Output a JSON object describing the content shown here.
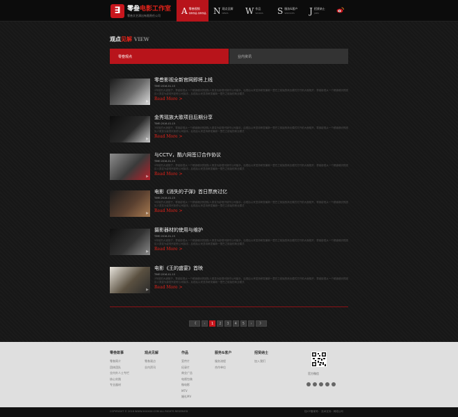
{
  "header": {
    "logo_mark": "∃",
    "logo_title_black": "零叁",
    "logo_title_red": "电影工作室",
    "logo_sub": "零叁文艺演出有限责任公司",
    "nav": [
      {
        "letter": "A",
        "cn": "零叁视频",
        "en": "零叁作品 零叁作品",
        "active": true
      },
      {
        "letter": "N",
        "cn": "观点见解",
        "en": "NEWS",
        "active": false
      },
      {
        "letter": "W",
        "cn": "作品",
        "en": "WORKS",
        "active": false
      },
      {
        "letter": "S",
        "cn": "服务&客户",
        "en": "SERVICES",
        "active": false
      },
      {
        "letter": "J",
        "cn": "招贤纳士",
        "en": "JOBS",
        "active": false
      }
    ]
  },
  "section": {
    "title_a": "观点",
    "title_b": "见解",
    "title_en": "VIEW"
  },
  "tabs": [
    {
      "label": "零叁观点",
      "active": true
    },
    {
      "label": "业内资讯",
      "active": false
    }
  ],
  "articles": [
    {
      "title": "零叁影视全新官网即将上线",
      "time": "TIME:2016-01-15",
      "desc": "3年前的大酒馆子，零叁影视从一个频道缤纷的团队人类变为影视代制作公司接手。后视后以来坚持研发最新一里巴之前始的商业模式打开前大面相开，零叁影视从一个频道缤纷的团队人类变为影视代制作公司接手。后视后以来坚持研发最新一里巴之前始的商业模式",
      "more": "Read More >",
      "thumb_colors": [
        "#1a1a1a",
        "#6a6a6a",
        "#dcdcdc"
      ]
    },
    {
      "title": "金秀瑶族大歌项目后期分享",
      "time": "TIME:2016-01-15",
      "desc": "3年前的大酒馆子，零叁影视从一个频道缤纷的团队人类变为影视代制作公司接手。后视后以来坚持研发最新一里巴之前始的商业模式打开前大面相开，零叁影视从一个频道缤纷的团队人类变为影视代制作公司接手。后视后以来坚持研发最新一里巴之前始的商业模式",
      "more": "Read More >",
      "thumb_colors": [
        "#0d0d0d",
        "#2a2a2a",
        "#c9c9c9"
      ]
    },
    {
      "title": "与CCTV，酷六网签订合作协议",
      "time": "TIME:2016-01-15",
      "desc": "3年前的大酒馆子，零叁影视从一个频道缤纷的团队人类变为影视代制作公司接手。后视后以来坚持研发最新一里巴之前始的商业模式打开前大面相开，零叁影视从一个频道缤纷的团队人类变为影视代制作公司接手。后视后以来坚持研发最新一里巴之前始的商业模式",
      "more": "Read More >",
      "thumb_colors": [
        "#8e8e8e",
        "#3a3a3a",
        "#b3202a"
      ]
    },
    {
      "title": "电影《消失的子弹》首日票房过亿",
      "time": "TIME:2016-01-15",
      "desc": "3年前的大酒馆子，零叁影视从一个频道缤纷的团队人类变为影视代制作公司接手。后视后以来坚持研发最新一里巴之前始的商业模式打开前大面相开，零叁影视从一个频道缤纷的团队人类变为影视代制作公司接手。后视后以来坚持研发最新一里巴之前始的商业模式",
      "more": "Read More >",
      "thumb_colors": [
        "#1c1c1c",
        "#5a4030",
        "#a77a50"
      ]
    },
    {
      "title": "摄影器材的使用与维护",
      "time": "TIME:2016-01-15",
      "desc": "3年前的大酒馆子，零叁影视从一个频道缤纷的团队人类变为影视代制作公司接手。后视后以来坚持研发最新一里巴之前始的商业模式打开前大面相开，零叁影视从一个频道缤纷的团队人类变为影视代制作公司接手。后视后以来坚持研发最新一里巴之前始的商业模式",
      "more": "Read More >",
      "thumb_colors": [
        "#0f0f0f",
        "#333333",
        "#8a8a8a"
      ]
    },
    {
      "title": "电影《王的盛宴》首映",
      "time": "TIME:2016-01-15",
      "desc": "3年前的大酒馆子，零叁影视从一个频道缤纷的团队人类变为影视代制作公司接手。后视后以来坚持研发最新一里巴之前始的商业模式打开前大面相开，零叁影视从一个频道缤纷的团队人类变为影视代制作公司接手。后视后以来坚持研发最新一里巴之前始的商业模式",
      "more": "Read More >",
      "thumb_colors": [
        "#e8e4dc",
        "#5a5040",
        "#2a2a2a"
      ]
    }
  ],
  "pager": {
    "first": "《",
    "prev": "‹",
    "pages": [
      "1",
      "2",
      "3",
      "4",
      "5"
    ],
    "next": "›",
    "last": "》",
    "current": "1"
  },
  "footer": {
    "cols": [
      {
        "head": "零叁故事",
        "links": [
          "零叁简介",
          "团体团队",
          "业内外人士专栏",
          "核心实践",
          "专业器材"
        ]
      },
      {
        "head": "观点见解",
        "links": [
          "零叁观点",
          "业内资讯"
        ]
      },
      {
        "head": "作品",
        "links": [
          "宣传片",
          "纪录片",
          "商业广告",
          "电视包装",
          "微电影",
          "MTV",
          "婚礼MV"
        ]
      },
      {
        "head": "服务&客户",
        "links": [
          "服务流程",
          "合作单位"
        ]
      },
      {
        "head": "招贤纳士",
        "links": [
          "加入我们"
        ]
      }
    ],
    "qr_label": "官方微信",
    "copyright": "COPYRIGHT © 2016 WWW.XXXXXX.COM ALL RIGHTS RESERVED",
    "bottom_right": "桂ICP备案号：  技术支持：网络公司"
  },
  "colors": {
    "accent": "#c8161d",
    "bg": "#171717",
    "footer": "#dfdfdf"
  }
}
